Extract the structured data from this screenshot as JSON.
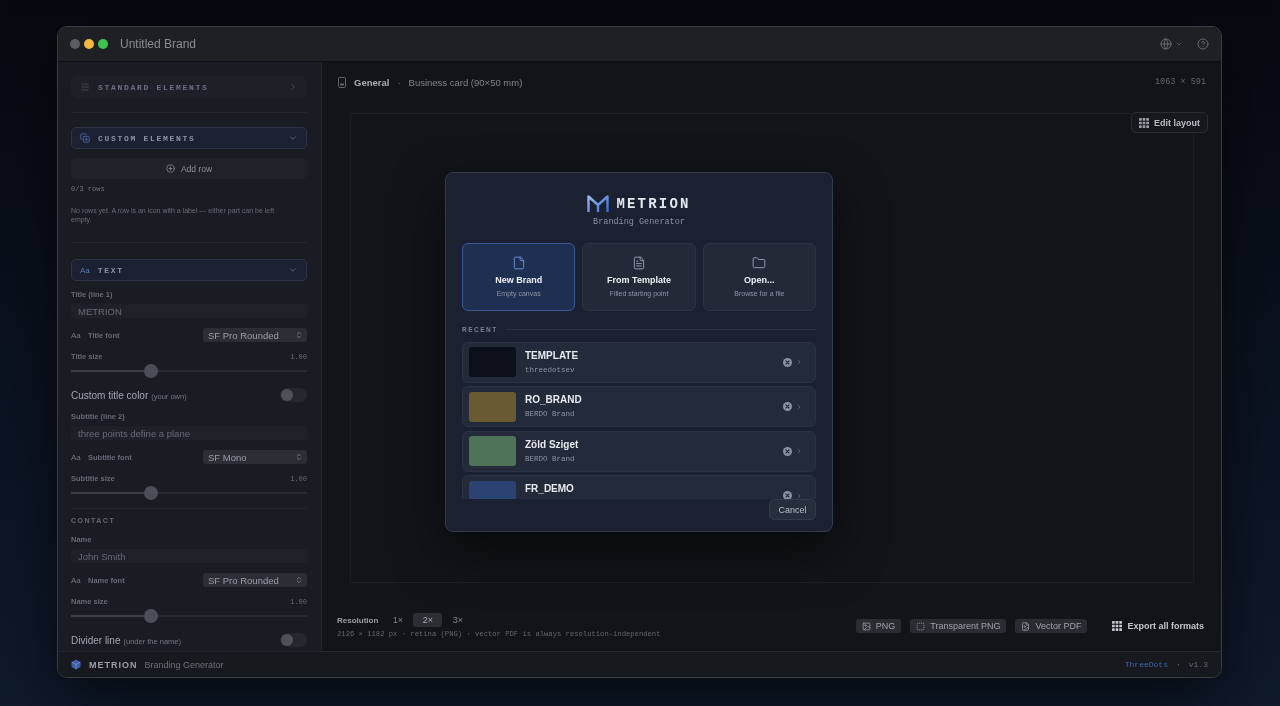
{
  "window": {
    "title": "Untitled Brand",
    "buttons": [
      {
        "color": "#5b5c60"
      },
      {
        "color": "#f4b63f"
      },
      {
        "color": "#3ec24c"
      }
    ]
  },
  "sidebar": {
    "standard_elements": {
      "title": "STANDARD ELEMENTS",
      "expanded": false
    },
    "custom_elements": {
      "title": "CUSTOM ELEMENTS",
      "expanded": true,
      "add_button": "Add row",
      "count": "0/3 rows",
      "empty_message": "No rows yet. A row is an icon with a label — either part can be left empty."
    },
    "text": {
      "glyph": "Aa",
      "title": "TEXT",
      "expanded": true,
      "controls": [
        {
          "kind": "field",
          "label": "Title (line 1)",
          "placeholder": "METRION"
        },
        {
          "kind": "font",
          "glyph": "Aa",
          "label": "Title font",
          "value": "SF Pro Rounded"
        },
        {
          "kind": "slider",
          "label": "Title size",
          "reading": "1.00",
          "level": 0.33
        },
        {
          "kind": "toggle",
          "label": "Custom title color",
          "note": "(your own)",
          "on": false
        },
        {
          "kind": "field",
          "label": "Subtitle (line 2)",
          "placeholder": "three points define a plane"
        },
        {
          "kind": "font",
          "glyph": "Aa",
          "label": "Subtitle font",
          "value": "SF Mono"
        },
        {
          "kind": "slider",
          "label": "Subtitle size",
          "reading": "1.00",
          "level": 0.33
        },
        {
          "kind": "divider"
        },
        {
          "kind": "heading",
          "label": "CONTACT"
        },
        {
          "kind": "field",
          "label": "Name",
          "placeholder": "John Smith"
        },
        {
          "kind": "font",
          "glyph": "Aa",
          "label": "Name font",
          "value": "SF Pro Rounded"
        },
        {
          "kind": "slider",
          "label": "Name size",
          "reading": "1.00",
          "level": 0.33
        },
        {
          "kind": "toggle",
          "label": "Divider line",
          "note": "(under the name)",
          "on": false
        }
      ]
    }
  },
  "toolbar": {
    "section": "General",
    "separator": "·",
    "format": "Business card (90×50 mm)",
    "size": "1063 × 591"
  },
  "canvas": {
    "edit_button": "Edit layout"
  },
  "dialog": {
    "brand": "METRION",
    "tagline": "Branding Generator",
    "actions": [
      {
        "title": "New Brand",
        "subtitle": "Empty canvas",
        "selected": true
      },
      {
        "title": "From Template",
        "subtitle": "Filled starting point",
        "selected": false
      },
      {
        "title": "Open...",
        "subtitle": "Browse for a file",
        "selected": false
      }
    ],
    "recent_label": "RECENT",
    "recent": [
      {
        "name": "TEMPLATE",
        "subtitle": "threedotsev",
        "color": "#0c1018"
      },
      {
        "name": "RO_BRAND",
        "subtitle": "BERDO Brand",
        "color": "#6a5a32"
      },
      {
        "name": "Zöld Sziget",
        "subtitle": "BERDO Brand",
        "color": "#4e7359"
      },
      {
        "name": "FR_DEMO",
        "color": "#2b4272"
      }
    ],
    "cancel": "Cancel"
  },
  "export": {
    "label": "Resolution",
    "scales": [
      {
        "label": "1×",
        "selected": false
      },
      {
        "label": "2×",
        "selected": true
      },
      {
        "label": "3×",
        "selected": false
      }
    ],
    "note": "2126 × 1182 px · retina (PNG) · vector PDF is always resolution-independent",
    "formats": [
      {
        "label": "PNG"
      },
      {
        "label": "Transparent PNG"
      },
      {
        "label": "Vector PDF"
      }
    ],
    "export_all": "Export all formats"
  },
  "footer": {
    "brand": "METRION",
    "tagline": "Branding Generator",
    "link": "ThreeDots",
    "separator": "·",
    "version": "v1.3"
  }
}
